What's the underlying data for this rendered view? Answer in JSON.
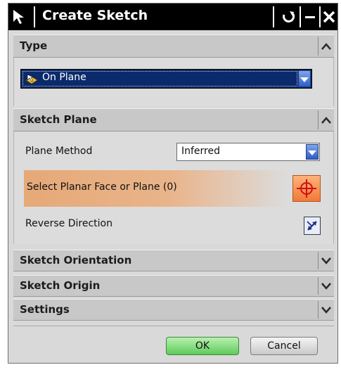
{
  "dialog": {
    "title": "Create Sketch",
    "icons": [
      "select-arrow-icon",
      "reset-icon",
      "minimize-icon",
      "close-icon"
    ]
  },
  "sections": {
    "type": {
      "label": "Type",
      "selected": "On Plane",
      "expanded": true
    },
    "sketch_plane": {
      "label": "Sketch Plane",
      "expanded": true,
      "plane_method_label": "Plane Method",
      "plane_method_value": "Inferred",
      "select_face_label": "Select Planar Face or Plane (0)",
      "reverse_direction_label": "Reverse Direction"
    },
    "sketch_orientation": {
      "label": "Sketch Orientation",
      "expanded": false
    },
    "sketch_origin": {
      "label": "Sketch Origin",
      "expanded": false
    },
    "settings": {
      "label": "Settings",
      "expanded": false
    }
  },
  "buttons": {
    "ok": "OK",
    "cancel": "Cancel"
  },
  "colors": {
    "titlebar": "#000000",
    "selection_highlight": "#0a2a6b",
    "active_selection": "#e6a978",
    "ok_green": "#5fcb5a"
  }
}
